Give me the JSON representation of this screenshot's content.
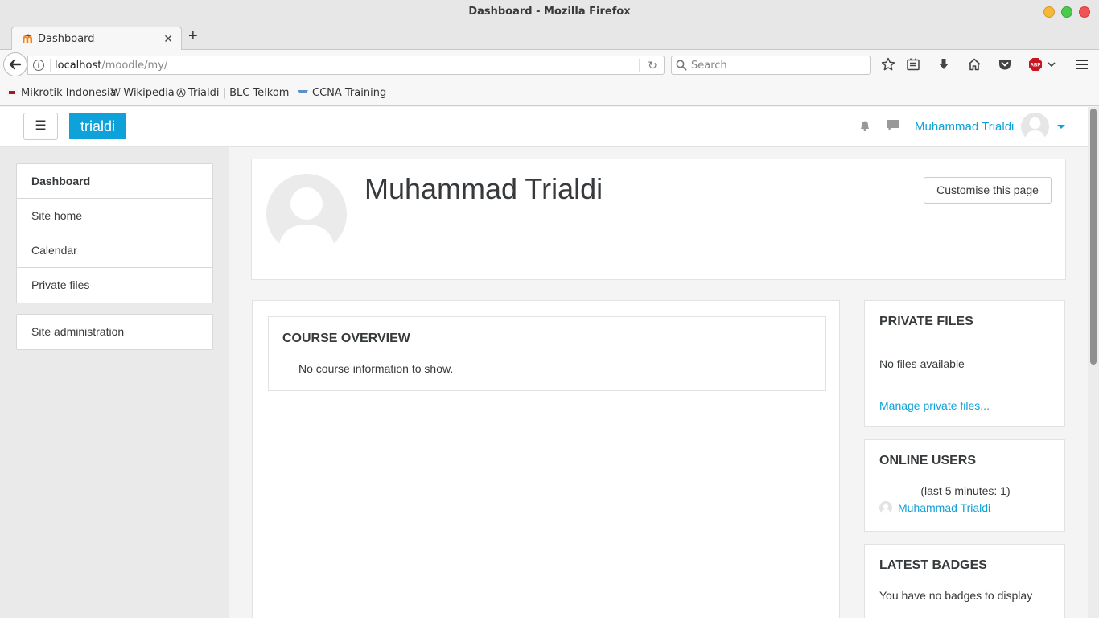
{
  "window": {
    "title": "Dashboard - Mozilla Firefox"
  },
  "tabs": [
    {
      "label": "Dashboard",
      "icon": "moodle-favicon"
    }
  ],
  "navbar": {
    "url_host": "localhost",
    "url_path": "/moodle/my/",
    "search_placeholder": "Search"
  },
  "bookmarks": [
    {
      "label": "Mikrotik Indonesia",
      "icon": "mikrotik-favicon"
    },
    {
      "label": "Wikipedia",
      "icon": "wikipedia-favicon"
    },
    {
      "label": "Trialdi | BLC Telkom",
      "icon": "blc-favicon"
    },
    {
      "label": "CCNA Training",
      "icon": "ccna-favicon"
    }
  ],
  "header": {
    "brand": "trialdi",
    "menu_glyph": "☰",
    "username": "Muhammad Trialdi"
  },
  "nav": {
    "items": [
      {
        "label": "Dashboard",
        "active": true
      },
      {
        "label": "Site home",
        "active": false
      },
      {
        "label": "Calendar",
        "active": false
      },
      {
        "label": "Private files",
        "active": false
      }
    ],
    "admin": {
      "label": "Site administration"
    }
  },
  "profile": {
    "fullname": "Muhammad Trialdi",
    "customise_label": "Customise this page"
  },
  "course_overview": {
    "title": "COURSE OVERVIEW",
    "message": "No course information to show."
  },
  "blocks": {
    "private_files": {
      "title": "PRIVATE FILES",
      "message": "No files available",
      "link": "Manage private files..."
    },
    "online_users": {
      "title": "ONLINE USERS",
      "subtitle": "(last 5 minutes: 1)",
      "users": [
        "Muhammad Trialdi"
      ]
    },
    "latest_badges": {
      "title": "LATEST BADGES",
      "message": "You have no badges to display"
    }
  },
  "colors": {
    "accent": "#0fa1d9",
    "text": "#373a3c"
  }
}
